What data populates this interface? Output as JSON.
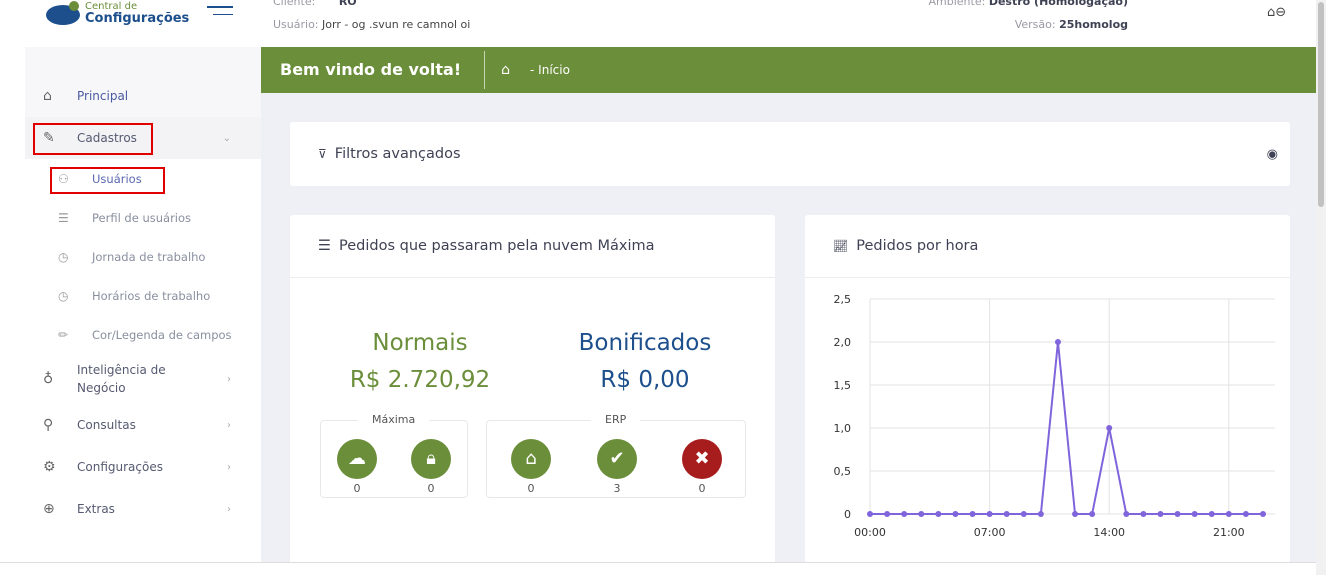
{
  "header": {
    "logo_line1": "Central de",
    "logo_line2": "Configurações",
    "cliente_label": "Cliente:",
    "cliente_value": "RO",
    "usuario_label": "Usuário:",
    "usuario_value": "Jorr - og  .svun re camnol oi",
    "ambiente_label": "Ambiente:",
    "ambiente_value": "Destro (Homologação)",
    "versao_label": "Versão:",
    "versao_value": "25homolog"
  },
  "sidebar": {
    "items": [
      {
        "label": "Principal",
        "icon": "home-icon"
      },
      {
        "label": "Cadastros",
        "icon": "edit-icon"
      },
      {
        "label": "Usuários",
        "icon": "users-icon"
      },
      {
        "label": "Perfil de usuários",
        "icon": "checklist-icon"
      },
      {
        "label": "Jornada de trabalho",
        "icon": "clock-icon"
      },
      {
        "label": "Horários de trabalho",
        "icon": "clock-icon"
      },
      {
        "label": "Cor/Legenda de campos",
        "icon": "pencil-icon"
      },
      {
        "label": "Inteligência de Negócio",
        "icon": "lightbulb-icon"
      },
      {
        "label": "Consultas",
        "icon": "search-icon"
      },
      {
        "label": "Configurações",
        "icon": "gear-icon"
      },
      {
        "label": "Extras",
        "icon": "plus-circle-icon"
      }
    ]
  },
  "banner": {
    "title": "Bem vindo de volta!",
    "breadcrumb": "- Início"
  },
  "filters": {
    "title": "Filtros avançados"
  },
  "orders": {
    "title": "Pedidos que passaram pela nuvem Máxima",
    "normais_label": "Normais",
    "normais_value": "R$ 2.720,92",
    "bonificados_label": "Bonificados",
    "bonificados_value": "R$ 0,00",
    "maxima_label": "Máxima",
    "maxima_counts": [
      "0",
      "0"
    ],
    "erp_label": "ERP",
    "erp_counts": [
      "0",
      "3",
      "0"
    ],
    "colors": {
      "green": "#6b8e3a",
      "red": "#a71c1c",
      "normais": "#6b8e3a",
      "bonificados": "#1d4f8c"
    }
  },
  "chart_data": {
    "type": "line",
    "title": "Pedidos por hora",
    "x": [
      "00:00",
      "01:00",
      "02:00",
      "03:00",
      "04:00",
      "05:00",
      "06:00",
      "07:00",
      "08:00",
      "09:00",
      "10:00",
      "11:00",
      "12:00",
      "13:00",
      "14:00",
      "15:00",
      "16:00",
      "17:00",
      "18:00",
      "19:00",
      "20:00",
      "21:00",
      "22:00",
      "23:00"
    ],
    "values": [
      0,
      0,
      0,
      0,
      0,
      0,
      0,
      0,
      0,
      0,
      0,
      2,
      0,
      0,
      1,
      0,
      0,
      0,
      0,
      0,
      0,
      0,
      0,
      0
    ],
    "xticks": [
      "00:00",
      "07:00",
      "14:00",
      "21:00"
    ],
    "yticks": [
      "0",
      "0,5",
      "1,0",
      "1,5",
      "2,0",
      "2,5"
    ],
    "ylim": [
      0,
      2.5
    ],
    "grid": true,
    "color": "#8064dc"
  }
}
